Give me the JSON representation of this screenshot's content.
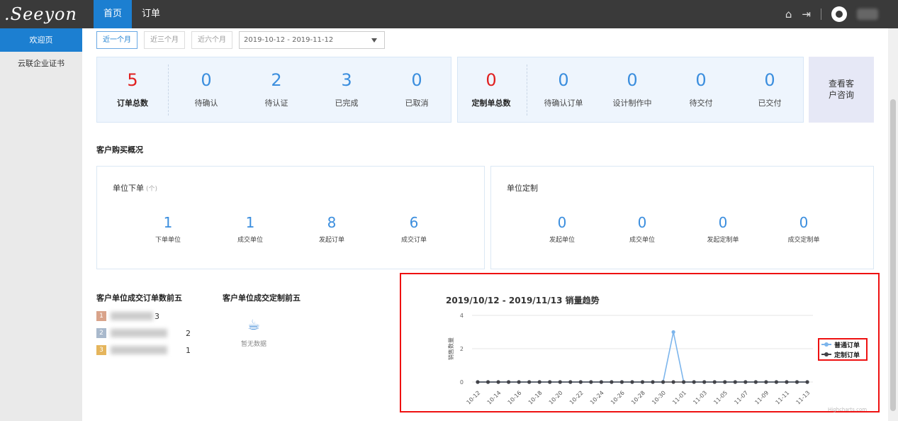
{
  "header": {
    "logo_text": ".Seeyon",
    "nav": [
      {
        "label": "首页",
        "active": true
      },
      {
        "label": "订单",
        "active": false
      }
    ]
  },
  "sidebar": {
    "items": [
      {
        "label": "欢迎页",
        "active": true
      },
      {
        "label": "云联企业证书",
        "active": false
      }
    ]
  },
  "filters": {
    "buttons": [
      {
        "label": "近一个月",
        "active": true
      },
      {
        "label": "近三个月",
        "active": false
      },
      {
        "label": "近六个月",
        "active": false
      }
    ],
    "date_range": "2019-10-12 - 2019-11-12"
  },
  "orders_summary": {
    "total": {
      "value": "5",
      "label": "订单总数"
    },
    "items": [
      {
        "value": "0",
        "label": "待确认"
      },
      {
        "value": "2",
        "label": "待认证"
      },
      {
        "value": "3",
        "label": "已完成"
      },
      {
        "value": "0",
        "label": "已取消"
      }
    ]
  },
  "custom_summary": {
    "total": {
      "value": "0",
      "label": "定制单总数"
    },
    "items": [
      {
        "value": "0",
        "label": "待确认订单"
      },
      {
        "value": "0",
        "label": "设计制作中"
      },
      {
        "value": "0",
        "label": "待交付"
      },
      {
        "value": "0",
        "label": "已交付"
      }
    ]
  },
  "consult_button": "查看客户咨询",
  "purchase_overview": {
    "title": "客户购买概况",
    "unit_orders": {
      "title": "单位下单",
      "unit": "(个)",
      "stats": [
        {
          "value": "1",
          "label": "下单单位"
        },
        {
          "value": "1",
          "label": "成交单位"
        },
        {
          "value": "8",
          "label": "发起订单"
        },
        {
          "value": "6",
          "label": "成交订单"
        }
      ]
    },
    "unit_custom": {
      "title": "单位定制",
      "stats": [
        {
          "value": "0",
          "label": "发起单位"
        },
        {
          "value": "0",
          "label": "成交单位"
        },
        {
          "value": "0",
          "label": "发起定制单"
        },
        {
          "value": "0",
          "label": "成交定制单"
        }
      ]
    }
  },
  "top5_orders": {
    "title": "客户单位成交订单数前五",
    "rows": [
      {
        "rank": "1",
        "value": "3",
        "color": "#d9a38a"
      },
      {
        "rank": "2",
        "value": "2",
        "color": "#a9b9cc"
      },
      {
        "rank": "3",
        "value": "1",
        "color": "#e5b55c"
      }
    ]
  },
  "top5_custom": {
    "title": "客户单位成交定制前五",
    "empty_text": "暂无数据"
  },
  "chart_data": {
    "type": "line",
    "title": "2019/10/12 - 2019/11/13 销量趋势",
    "ylabel": "销售数量",
    "xlabel": "",
    "ylim": [
      0,
      4
    ],
    "yticks": [
      "0",
      "2",
      "4"
    ],
    "x": [
      "10-12",
      "10-13",
      "10-14",
      "10-15",
      "10-16",
      "10-17",
      "10-18",
      "10-19",
      "10-20",
      "10-21",
      "10-22",
      "10-23",
      "10-24",
      "10-25",
      "10-26",
      "10-27",
      "10-28",
      "10-29",
      "10-30",
      "10-31",
      "11-01",
      "11-02",
      "11-03",
      "11-04",
      "11-05",
      "11-06",
      "11-07",
      "11-08",
      "11-09",
      "11-10",
      "11-11",
      "11-12",
      "11-13"
    ],
    "xtick_labels": [
      "10-12",
      "10-14",
      "10-16",
      "10-18",
      "10-20",
      "10-22",
      "10-24",
      "10-26",
      "10-28",
      "10-30",
      "11-01",
      "11-03",
      "11-05",
      "11-07",
      "11-09",
      "11-11",
      "11-13"
    ],
    "series": [
      {
        "name": "普通订单",
        "color": "#7cb5ec",
        "values": [
          0,
          0,
          0,
          0,
          0,
          0,
          0,
          0,
          0,
          0,
          0,
          0,
          0,
          0,
          0,
          0,
          0,
          0,
          0,
          3,
          0,
          0,
          0,
          0,
          0,
          0,
          0,
          0,
          0,
          0,
          0,
          0,
          0
        ]
      },
      {
        "name": "定制订单",
        "color": "#434348",
        "values": [
          0,
          0,
          0,
          0,
          0,
          0,
          0,
          0,
          0,
          0,
          0,
          0,
          0,
          0,
          0,
          0,
          0,
          0,
          0,
          0,
          0,
          0,
          0,
          0,
          0,
          0,
          0,
          0,
          0,
          0,
          0,
          0,
          0
        ]
      }
    ],
    "legend": "right",
    "grid": true,
    "credit": "Highcharts.com"
  }
}
